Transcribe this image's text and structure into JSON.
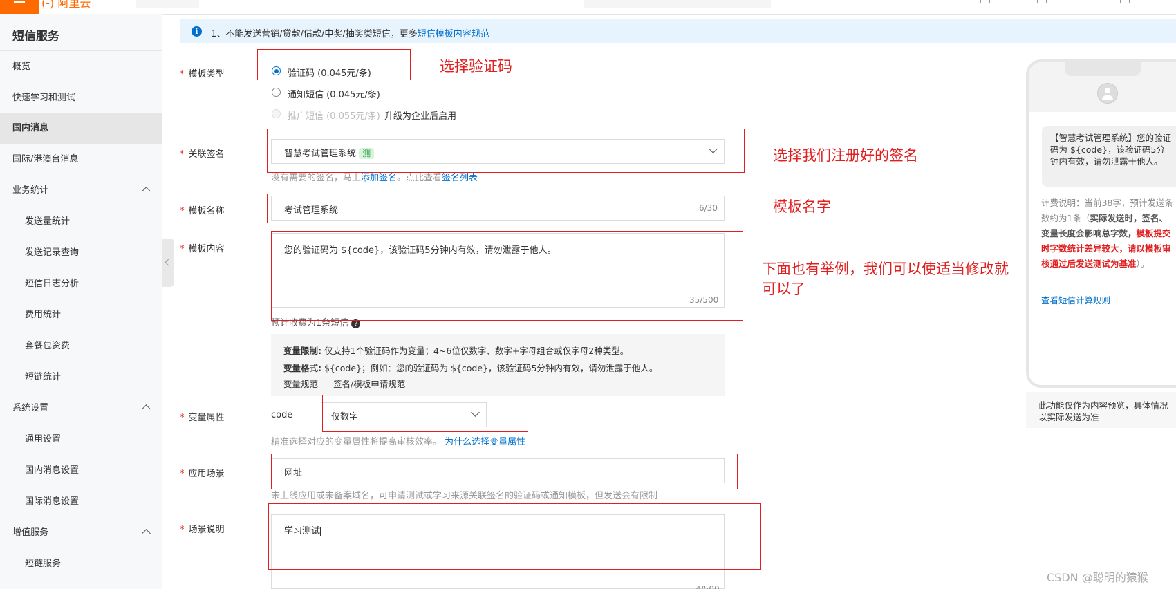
{
  "sidebar": {
    "title": "短信服务",
    "items": [
      {
        "label": "概览"
      },
      {
        "label": "快速学习和测试"
      },
      {
        "label": "国内消息"
      },
      {
        "label": "国际/港澳台消息"
      },
      {
        "label": "业务统计"
      },
      {
        "label": "发送量统计"
      },
      {
        "label": "发送记录查询"
      },
      {
        "label": "短信日志分析"
      },
      {
        "label": "费用统计"
      },
      {
        "label": "套餐包资费"
      },
      {
        "label": "短链统计"
      },
      {
        "label": "系统设置"
      },
      {
        "label": "通用设置"
      },
      {
        "label": "国内消息设置"
      },
      {
        "label": "国际消息设置"
      },
      {
        "label": "增值服务"
      },
      {
        "label": "短链服务"
      }
    ]
  },
  "notice": {
    "text": "1、不能发送营销/贷款/借款/中奖/抽奖类短信，更多",
    "link": "短信模板内容规范"
  },
  "form": {
    "required_mark": "*",
    "template_type": {
      "label": "模板类型",
      "options": [
        {
          "label": "验证码 (0.045元/条)",
          "checked": true
        },
        {
          "label": "通知短信 (0.045元/条)",
          "checked": false
        },
        {
          "label": "推广短信 (0.055元/条)",
          "note": "升级为企业后启用",
          "disabled": true
        }
      ]
    },
    "signature": {
      "label": "关联签名",
      "value": "智慧考试管理系统",
      "badge": "测",
      "hint_prefix": "没有需要的签名，马上",
      "hint_link1": "添加签名",
      "hint_middle": "。点此查看",
      "hint_link2": "签名列表"
    },
    "template_name": {
      "label": "模板名称",
      "value": "考试管理系统",
      "count": "6/30"
    },
    "template_content": {
      "label": "模板内容",
      "value": "您的验证码为 ${code}，该验证码5分钟内有效，请勿泄露于他人。",
      "count": "35/500",
      "estimate": "预计收费为1条短信",
      "help_icon": "question-circle-icon"
    },
    "variable_info": {
      "limit_label": "变量限制:",
      "limit_text": "仅支持1个验证码作为变量；4~6位仅数字、数字+字母组合或仅字母2种类型。",
      "format_label": "变量格式:",
      "format_text": "${code}；例如：您的验证码为 ${code}，该验证码5分钟内有效，请勿泄露于他人。",
      "link1": "变量规范",
      "link2": "签名/模板申请规范"
    },
    "variable_attr": {
      "label": "变量属性",
      "var_name": "code",
      "value": "仅数字",
      "hint": "精准选择对应的变量属性将提高审核效率。",
      "hint_link": "为什么选择变量属性"
    },
    "scene": {
      "label": "应用场景",
      "value": "网址",
      "hint": "未上线应用或未备案域名，可申请测试或学习来源关联签名的验证码或通知模板，但发送会有限制"
    },
    "scene_desc": {
      "label": "场景说明",
      "value": "学习测试",
      "count": "4/500"
    }
  },
  "annotations": {
    "choose_code": "选择验证码",
    "choose_sign": "选择我们注册好的签名",
    "template_name": "模板名字",
    "example_line1": "下面也有举例，我们可以使适当修改就",
    "example_line2": "可以了"
  },
  "preview": {
    "message": "【智慧考试管理系统】您的验证码为 ${code}，该验证码5分钟内有效，请勿泄露于他人。",
    "billing_1": "计费说明：当前38字，预计发送条数约为1条（",
    "billing_bold": "实际发送时，签名、变量长度会影响总字数，",
    "billing_red": "模板提交时字数统计差异较大，请以模板审核通过后发送测试为基准",
    "billing_end": "）。",
    "calc_link": "查看短信计算规则",
    "note": "此功能仅作为内容预览，具体情况以实际发送为准"
  },
  "watermark": "CSDN @聪明的猿猴",
  "colors": {
    "brand": "#ff6a00",
    "link": "#0070cc",
    "annotation": "#e02020"
  }
}
